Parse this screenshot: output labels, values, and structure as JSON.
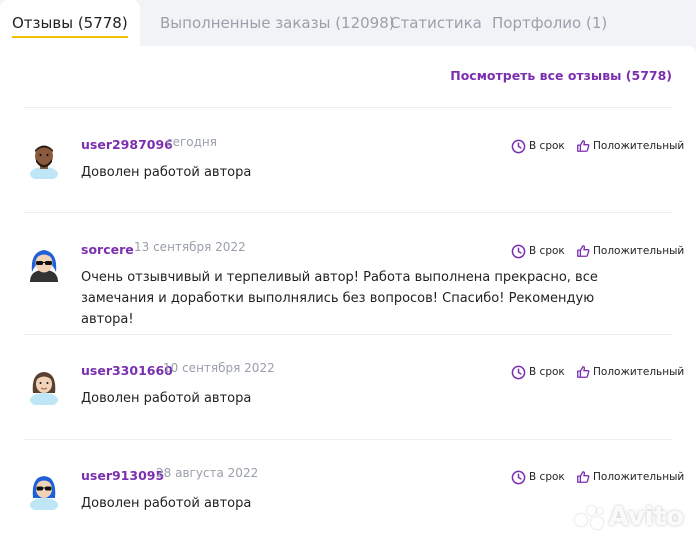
{
  "tabs": [
    {
      "label": "Отзывы (5778)",
      "active": true
    },
    {
      "label": "Выполненные заказы (12098)",
      "active": false
    },
    {
      "label": "Статистика",
      "active": false
    },
    {
      "label": "Портфолио (1)",
      "active": false
    }
  ],
  "see_all_label": "Посмотреть все отзывы (5778)",
  "badges": {
    "on_time": "В срок",
    "positive": "Положительный"
  },
  "reviews": [
    {
      "user": "user2987096",
      "date": "сегодня",
      "text": "Доволен работой автора"
    },
    {
      "user": "sorcere",
      "date": "13 сентября 2022",
      "text": "Очень отзывчивый и терпеливый автор! Работа выполнена прекрасно, все замечания и доработки выполнялись без вопросов! Спасибо! Рекомендую автора!"
    },
    {
      "user": "user3301660",
      "date": "10 сентября 2022",
      "text": "Доволен работой автора"
    },
    {
      "user": "user913095",
      "date": "28 августа 2022",
      "text": "Доволен работой автора"
    }
  ],
  "watermark": "Avito",
  "colors": {
    "accent": "#7b2fb0",
    "tab_underline": "#f2c200",
    "muted": "#9aa0ab"
  }
}
